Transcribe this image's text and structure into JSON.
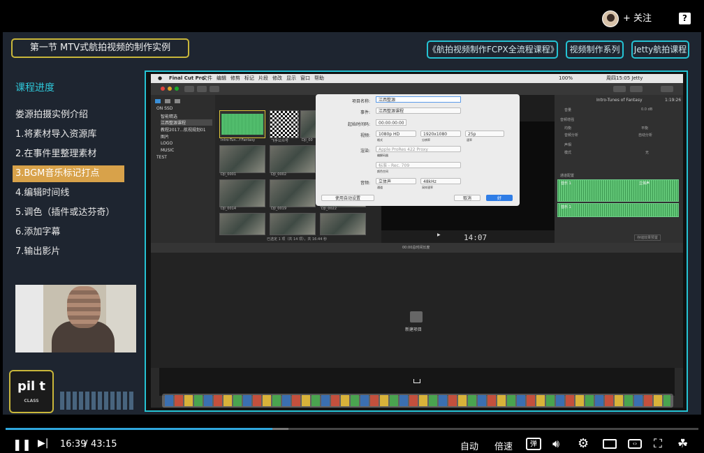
{
  "player": {
    "follow_label": "关注",
    "follow_plus": "+",
    "report_icon": "?",
    "current_time": "16:39",
    "separator": "/",
    "duration": "43:15",
    "progress": 0.385,
    "auto_label": "自动",
    "speed_label": "倍速",
    "danmaku_label": "弹"
  },
  "slide": {
    "lesson_title": "第一节 MTV式航拍视频的制作实例",
    "tags": [
      "《航拍视频制作FCPX全流程课程》",
      "视频制作系列",
      "Jetty航拍课程"
    ],
    "progress_title": "课程进度",
    "menu": [
      "娄源拍摄实例介绍",
      "1.将素材导入资源库",
      "2.在事件里整理素材",
      "3.BGM音乐标记打点",
      "4.编辑时间线",
      "5.调色（插件或达芬奇）",
      "6.添加字幕",
      "7.输出影片"
    ],
    "active_index": 3,
    "logo_text": "pil t",
    "logo_sub": "CLASS"
  },
  "fcp": {
    "menubar": [
      "Final Cut Pro",
      "文件",
      "编辑",
      "修剪",
      "标记",
      "片段",
      "修改",
      "显示",
      "窗口",
      "帮助"
    ],
    "menubar_right": "周四15:05  Jetty",
    "battery": "100%",
    "library": [
      "ON SSD",
      "智能精选",
      "江西整源课程",
      "教程2017...航视规划01",
      "图片",
      "LOGO",
      "MUSIC",
      "TEST"
    ],
    "thumbs": [
      "Intro-Tun...f Fantasy",
      "飞手公众号",
      "DJI_00",
      "DJI_0001",
      "DJI_0002",
      "DJI_0014",
      "DJI_0019",
      "DJI_0022"
    ],
    "browser_status": "已选定 1 项（共 14 项），共 16:44 秒",
    "viewer_timecode": "14:07",
    "inspector_title": "Intro-Tunes of Fantasy",
    "inspector_time": "1:19:26",
    "inspector_rows": [
      "音量",
      "音频增强",
      "均衡",
      "音频分析",
      "声相",
      "模式",
      "通道配置"
    ],
    "inspector_values": [
      "0.0 dB",
      "平衡",
      "自动分析",
      "无"
    ],
    "channel_1": "音乐 1",
    "channel_2": "音乐 1",
    "stereo_label": "立体声",
    "save_effects": "存储效果预置",
    "timeline_info": "00:00总时间长度",
    "new_project": "新建项目",
    "dialog": {
      "name_label": "项目名称:",
      "name_value": "江西整源",
      "event_label": "事件:",
      "event_value": "江西整源课程",
      "start_label": "起始时间码:",
      "start_value": "00:00:00:00",
      "video_label": "视频:",
      "video_format": "1080p HD",
      "video_format_caption": "格式",
      "video_res": "1920x1080",
      "video_res_caption": "分辨率",
      "video_rate": "25p",
      "video_rate_caption": "速率",
      "render_label": "渲染:",
      "render_codec": "Apple ProRes 422 Proxy",
      "render_caption": "编解码器",
      "color_space": "标准 - Rec. 709",
      "color_caption": "颜色空间",
      "audio_label": "音频:",
      "audio_channels": "立体声",
      "audio_channels_caption": "通道",
      "audio_rate": "48kHz",
      "audio_rate_caption": "采样速率",
      "auto_settings": "使用自动设置",
      "cancel": "取消",
      "ok": "好"
    }
  },
  "colors": {
    "accent": "#25c3d4",
    "gold": "#c9b73a",
    "active_item": "#d8a24a",
    "seek": "#2fa6dc"
  }
}
